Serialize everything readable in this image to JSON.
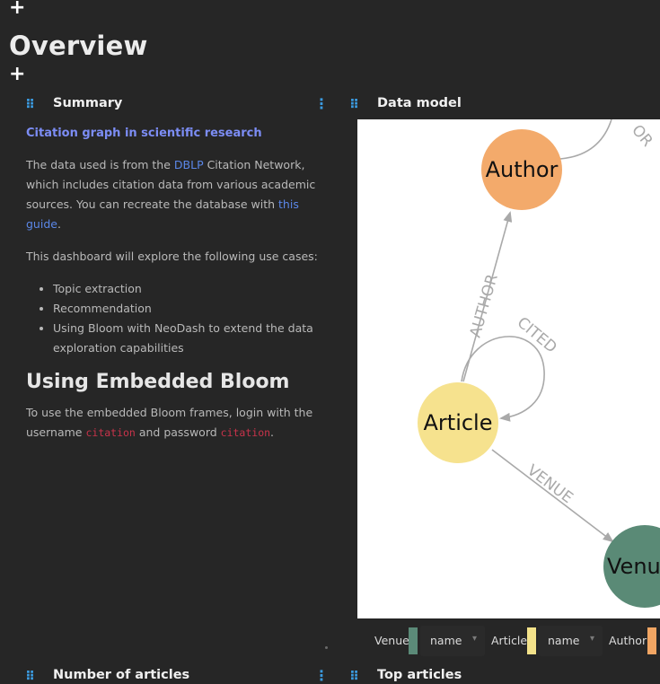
{
  "toolbar": {
    "add_top": "+",
    "add_section": "+"
  },
  "page": {
    "title": "Overview"
  },
  "cards": {
    "summary": {
      "title": "Summary",
      "subheading": "Citation graph in scientific research",
      "p1_before": "The data used is from the ",
      "p1_link": "DBLP",
      "p1_after": " Citation Network, which includes citation data from various academic sources. You can recreate the database with ",
      "p1_link2": "this guide",
      "p1_end": ".",
      "p2": "This dashboard will explore the following use cases:",
      "use_cases": [
        "Topic extraction",
        "Recommendation",
        "Using Bloom with NeoDash to extend the data exploration capabilities"
      ],
      "heading2": "Using Embedded Bloom",
      "p3_before": "To use the embedded Bloom frames, login with the username ",
      "username": "citation",
      "p3_mid": " and password ",
      "password": "citation",
      "p3_end": "."
    },
    "data_model": {
      "title": "Data model",
      "nodes": {
        "author": "Author",
        "article": "Article",
        "venue": "Venue"
      },
      "edges": {
        "author": "AUTHOR",
        "cited": "CITED",
        "venue": "VENUE",
        "self_author": "OR"
      },
      "legend": [
        {
          "label": "Venue",
          "color": "#5b8a78",
          "property": "name"
        },
        {
          "label": "Article",
          "color": "#f3e28a",
          "property": "name"
        },
        {
          "label": "Author",
          "color": "#f1a563"
        }
      ]
    },
    "bottom_left": {
      "title": "Number of articles"
    },
    "bottom_right": {
      "title": "Top articles"
    }
  },
  "colors": {
    "author_node": "#f3aa6b",
    "article_node": "#f6e28e",
    "venue_node": "#5a8a76",
    "accent": "#3b9be0"
  }
}
